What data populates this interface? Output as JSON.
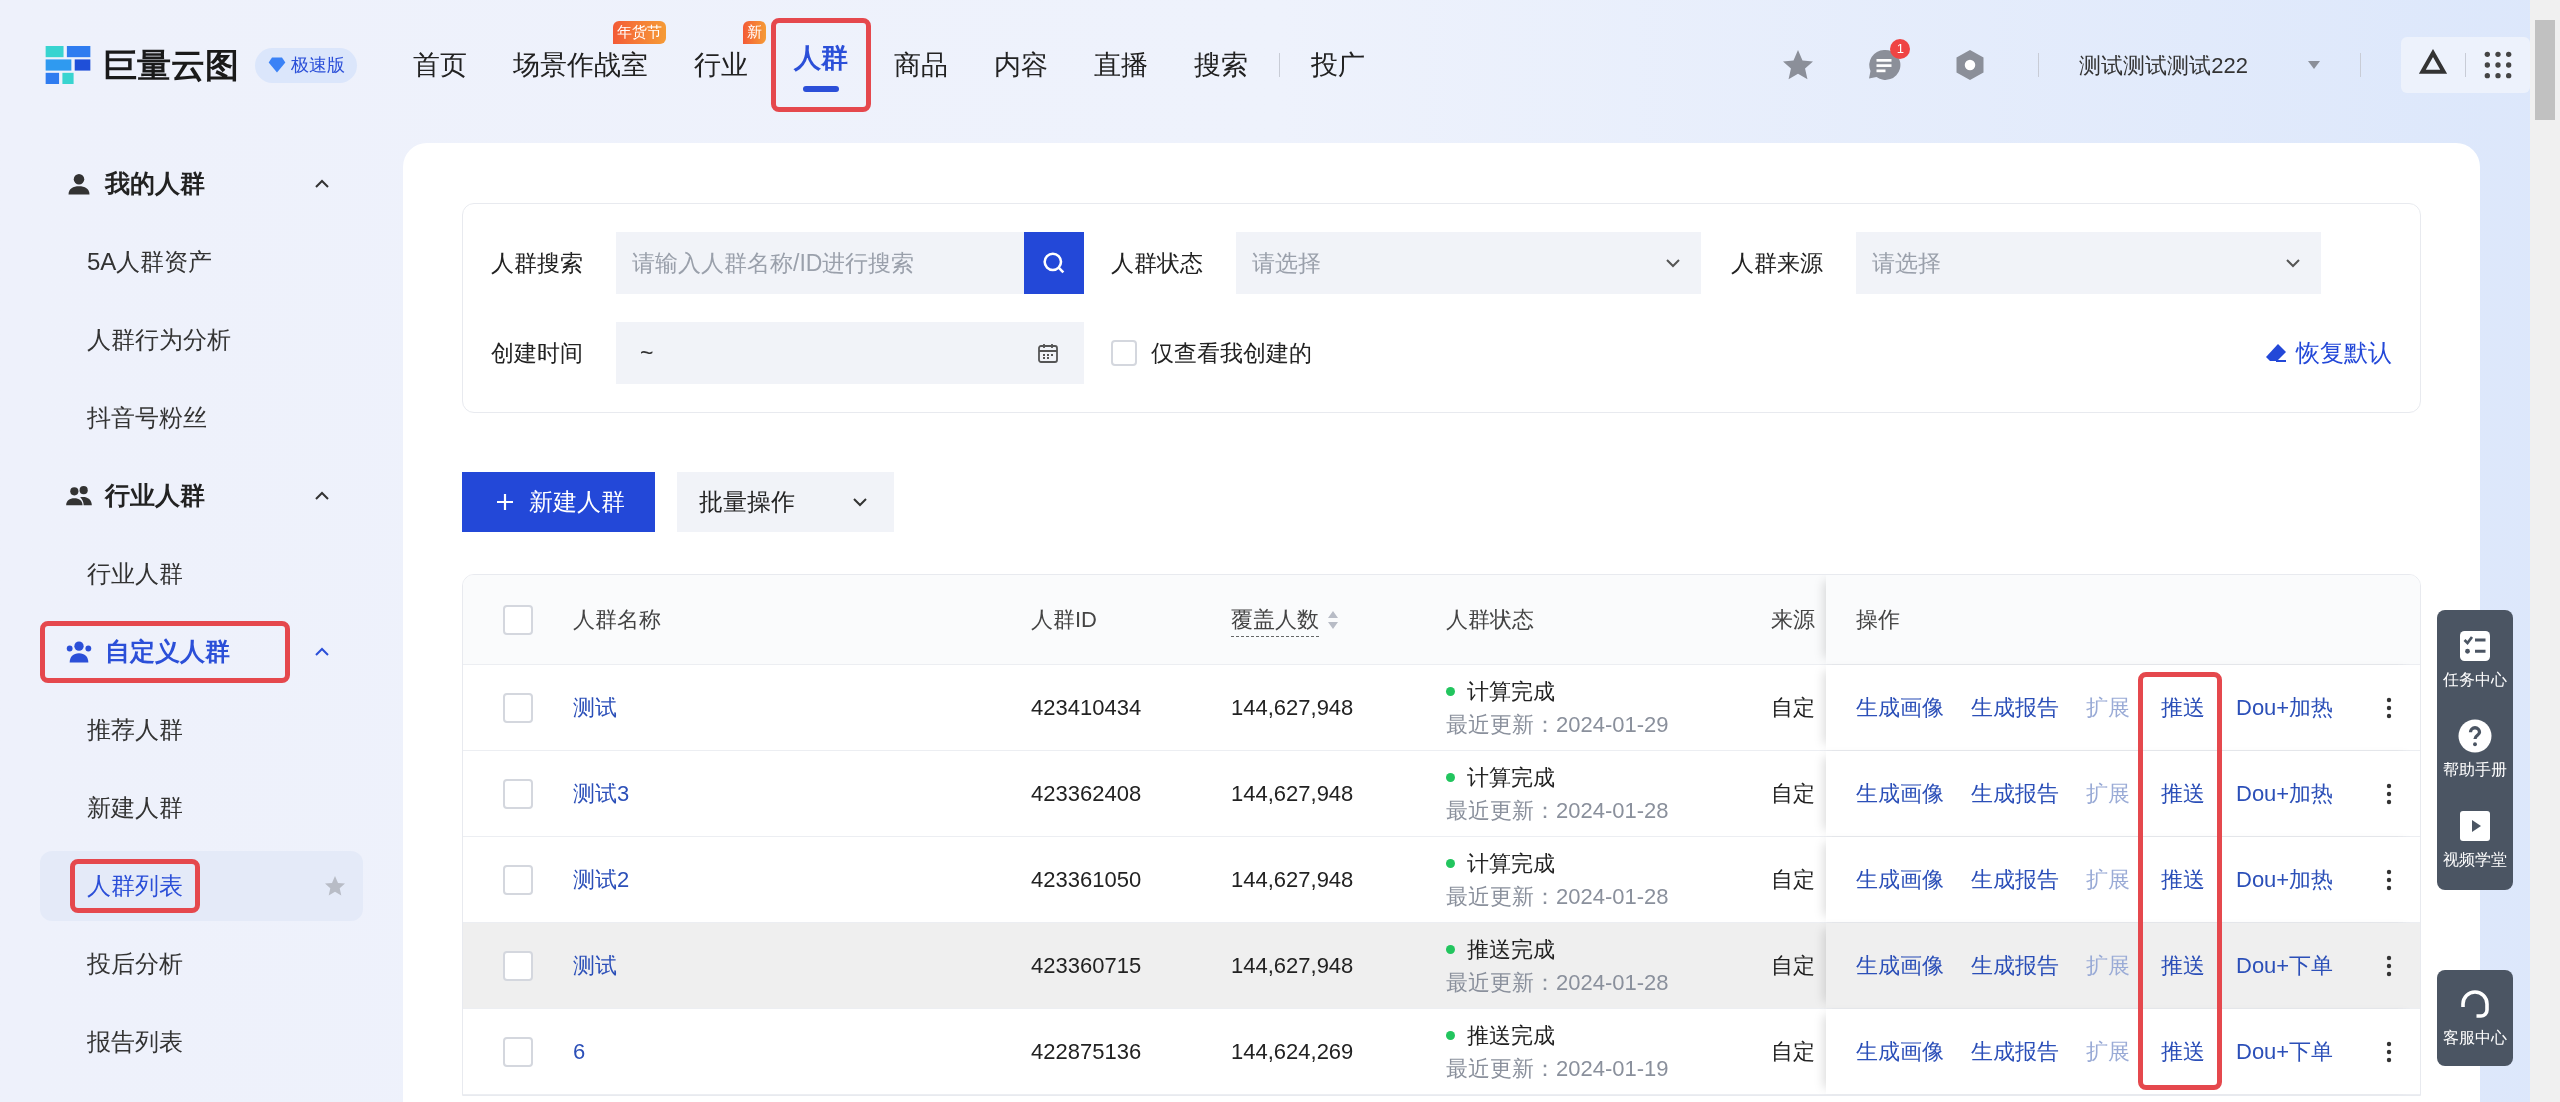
{
  "header": {
    "brand": "巨量云图",
    "edition_badge": "极速版",
    "nav": [
      {
        "label": "首页",
        "selected": false,
        "highlighted": false
      },
      {
        "label": "场景作战室",
        "selected": false,
        "highlighted": false,
        "tag": "年货节"
      },
      {
        "label": "行业",
        "selected": false,
        "highlighted": false,
        "tag": "新"
      },
      {
        "label": "人群",
        "selected": true,
        "highlighted": true
      },
      {
        "label": "商品",
        "selected": false,
        "highlighted": false
      },
      {
        "label": "内容",
        "selected": false,
        "highlighted": false
      },
      {
        "label": "直播",
        "selected": false,
        "highlighted": false
      },
      {
        "label": "搜索",
        "selected": false,
        "highlighted": false
      },
      {
        "label": "投广",
        "selected": false,
        "highlighted": false,
        "divider_before": true
      }
    ],
    "message_count": "1",
    "user": "测试测试测试222"
  },
  "sidebar": {
    "groups": [
      {
        "label": "我的人群",
        "kind": "user",
        "expanded": true,
        "highlighted": false,
        "children": [
          {
            "label": "5A人群资产",
            "selected": false,
            "highlighted": false
          },
          {
            "label": "人群行为分析",
            "selected": false,
            "highlighted": false
          },
          {
            "label": "抖音号粉丝",
            "selected": false,
            "highlighted": false
          }
        ]
      },
      {
        "label": "行业人群",
        "kind": "users",
        "expanded": true,
        "highlighted": false,
        "children": [
          {
            "label": "行业人群",
            "selected": false,
            "highlighted": false
          }
        ]
      },
      {
        "label": "自定义人群",
        "kind": "team",
        "expanded": true,
        "highlighted": true,
        "children": [
          {
            "label": "推荐人群",
            "selected": false,
            "highlighted": false
          },
          {
            "label": "新建人群",
            "selected": false,
            "highlighted": false
          },
          {
            "label": "人群列表",
            "selected": true,
            "highlighted": true
          },
          {
            "label": "投后分析",
            "selected": false,
            "highlighted": false
          },
          {
            "label": "报告列表",
            "selected": false,
            "highlighted": false
          }
        ]
      }
    ]
  },
  "filters": {
    "search": {
      "label": "人群搜索",
      "placeholder": "请输入人群名称/ID进行搜索"
    },
    "status": {
      "label": "人群状态",
      "placeholder": "请选择"
    },
    "source": {
      "label": "人群来源",
      "placeholder": "请选择"
    },
    "created": {
      "label": "创建时间",
      "value": "~"
    },
    "mine_only": {
      "label": "仅查看我创建的",
      "checked": false
    },
    "reset": "恢复默认"
  },
  "actions": {
    "create": "新建人群",
    "batch": "批量操作"
  },
  "table": {
    "columns": [
      "人群名称",
      "人群ID",
      "覆盖人数",
      "人群状态",
      "来源",
      "操作"
    ],
    "push_column_highlighted": true,
    "all_checked": false,
    "rows": [
      {
        "name": "测试",
        "id": "423410434",
        "coverage": "144,627,948",
        "status": "计算完成",
        "updated": "最近更新：2024-01-29",
        "source": "自定",
        "hovered": false,
        "checked": false,
        "ops": [
          "生成画像",
          "生成报告",
          "扩展",
          "推送",
          "Dou+加热"
        ]
      },
      {
        "name": "测试3",
        "id": "423362408",
        "coverage": "144,627,948",
        "status": "计算完成",
        "updated": "最近更新：2024-01-28",
        "source": "自定",
        "hovered": false,
        "checked": false,
        "ops": [
          "生成画像",
          "生成报告",
          "扩展",
          "推送",
          "Dou+加热"
        ]
      },
      {
        "name": "测试2",
        "id": "423361050",
        "coverage": "144,627,948",
        "status": "计算完成",
        "updated": "最近更新：2024-01-28",
        "source": "自定",
        "hovered": false,
        "checked": false,
        "ops": [
          "生成画像",
          "生成报告",
          "扩展",
          "推送",
          "Dou+加热"
        ]
      },
      {
        "name": "测试",
        "id": "423360715",
        "coverage": "144,627,948",
        "status": "推送完成",
        "updated": "最近更新：2024-01-28",
        "source": "自定",
        "hovered": true,
        "checked": false,
        "ops": [
          "生成画像",
          "生成报告",
          "扩展",
          "推送",
          "Dou+下单"
        ]
      },
      {
        "name": "6",
        "id": "422875136",
        "coverage": "144,624,269",
        "status": "推送完成",
        "updated": "最近更新：2024-01-19",
        "source": "自定",
        "hovered": false,
        "checked": false,
        "ops": [
          "生成画像",
          "生成报告",
          "扩展",
          "推送",
          "Dou+下单"
        ]
      }
    ]
  },
  "float_panel": {
    "items": [
      {
        "label": "任务中心",
        "kind": "tasks"
      },
      {
        "label": "帮助手册",
        "kind": "help"
      },
      {
        "label": "视频学堂",
        "kind": "video"
      }
    ],
    "service": "客服中心"
  }
}
